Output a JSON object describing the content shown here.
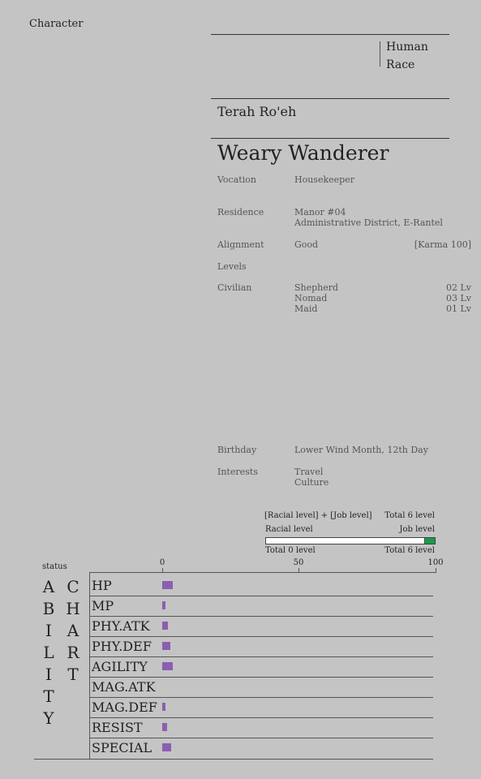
{
  "header": {
    "title": "Character"
  },
  "race": {
    "line1": "Human",
    "line2": "Race"
  },
  "name": "Terah Ro'eh",
  "title": "Weary Wanderer",
  "fields": {
    "vocation": {
      "label": "Vocation",
      "value": "Housekeeper"
    },
    "residence": {
      "label": "Residence",
      "line1": "Manor #04",
      "line2": "Administrative District, E-Rantel"
    },
    "alignment": {
      "label": "Alignment",
      "value": "Good",
      "karma": "[Karma 100]"
    },
    "levels": {
      "label": "Levels"
    },
    "civilian": {
      "label": "Civilian",
      "jobs": [
        {
          "name": "Shepherd",
          "level": "02 Lv"
        },
        {
          "name": "Nomad",
          "level": "03 Lv"
        },
        {
          "name": "Maid",
          "level": "01 Lv"
        }
      ]
    },
    "birthday": {
      "label": "Birthday",
      "value": "Lower Wind Month, 12th Day"
    },
    "interests": {
      "label": "Interests",
      "line1": "Travel",
      "line2": "Culture"
    }
  },
  "level_bar": {
    "formula": "[Racial level] + [Job level]",
    "total": "Total 6 level",
    "racial_label": "Racial level",
    "job_label": "Job level",
    "racial_total": "Total 0 level",
    "job_total": "Total 6 level",
    "racial_level": 0,
    "job_level": 6
  },
  "ability": {
    "status_label": "status",
    "title_col1": [
      "A",
      "B",
      "I",
      "L",
      "I",
      "T",
      "Y"
    ],
    "title_col2": [
      "C",
      "H",
      "A",
      "R",
      "T"
    ],
    "ticks": [
      "0",
      "50",
      "100"
    ],
    "axis_max": 100,
    "stats": [
      {
        "name": "HP",
        "value": 4
      },
      {
        "name": "MP",
        "value": 1.2
      },
      {
        "name": "PHY.ATK",
        "value": 2.2
      },
      {
        "name": "PHY.DEF",
        "value": 3
      },
      {
        "name": "AGILITY",
        "value": 4
      },
      {
        "name": "MAG.ATK",
        "value": 0
      },
      {
        "name": "MAG.DEF",
        "value": 1.2
      },
      {
        "name": "RESIST",
        "value": 1.8
      },
      {
        "name": "SPECIAL",
        "value": 3.2
      }
    ],
    "bar_color": "#8a5fb0",
    "job_bar_color": "#1a9a4a"
  }
}
